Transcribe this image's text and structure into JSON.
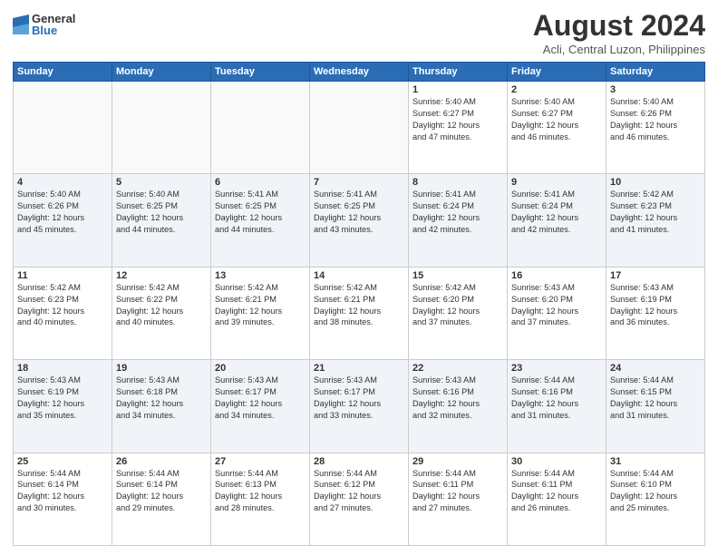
{
  "logo": {
    "general": "General",
    "blue": "Blue"
  },
  "title": "August 2024",
  "subtitle": "Acli, Central Luzon, Philippines",
  "weekdays": [
    "Sunday",
    "Monday",
    "Tuesday",
    "Wednesday",
    "Thursday",
    "Friday",
    "Saturday"
  ],
  "weeks": [
    [
      {
        "day": "",
        "info": ""
      },
      {
        "day": "",
        "info": ""
      },
      {
        "day": "",
        "info": ""
      },
      {
        "day": "",
        "info": ""
      },
      {
        "day": "1",
        "info": "Sunrise: 5:40 AM\nSunset: 6:27 PM\nDaylight: 12 hours\nand 47 minutes."
      },
      {
        "day": "2",
        "info": "Sunrise: 5:40 AM\nSunset: 6:27 PM\nDaylight: 12 hours\nand 46 minutes."
      },
      {
        "day": "3",
        "info": "Sunrise: 5:40 AM\nSunset: 6:26 PM\nDaylight: 12 hours\nand 46 minutes."
      }
    ],
    [
      {
        "day": "4",
        "info": "Sunrise: 5:40 AM\nSunset: 6:26 PM\nDaylight: 12 hours\nand 45 minutes."
      },
      {
        "day": "5",
        "info": "Sunrise: 5:40 AM\nSunset: 6:25 PM\nDaylight: 12 hours\nand 44 minutes."
      },
      {
        "day": "6",
        "info": "Sunrise: 5:41 AM\nSunset: 6:25 PM\nDaylight: 12 hours\nand 44 minutes."
      },
      {
        "day": "7",
        "info": "Sunrise: 5:41 AM\nSunset: 6:25 PM\nDaylight: 12 hours\nand 43 minutes."
      },
      {
        "day": "8",
        "info": "Sunrise: 5:41 AM\nSunset: 6:24 PM\nDaylight: 12 hours\nand 42 minutes."
      },
      {
        "day": "9",
        "info": "Sunrise: 5:41 AM\nSunset: 6:24 PM\nDaylight: 12 hours\nand 42 minutes."
      },
      {
        "day": "10",
        "info": "Sunrise: 5:42 AM\nSunset: 6:23 PM\nDaylight: 12 hours\nand 41 minutes."
      }
    ],
    [
      {
        "day": "11",
        "info": "Sunrise: 5:42 AM\nSunset: 6:23 PM\nDaylight: 12 hours\nand 40 minutes."
      },
      {
        "day": "12",
        "info": "Sunrise: 5:42 AM\nSunset: 6:22 PM\nDaylight: 12 hours\nand 40 minutes."
      },
      {
        "day": "13",
        "info": "Sunrise: 5:42 AM\nSunset: 6:21 PM\nDaylight: 12 hours\nand 39 minutes."
      },
      {
        "day": "14",
        "info": "Sunrise: 5:42 AM\nSunset: 6:21 PM\nDaylight: 12 hours\nand 38 minutes."
      },
      {
        "day": "15",
        "info": "Sunrise: 5:42 AM\nSunset: 6:20 PM\nDaylight: 12 hours\nand 37 minutes."
      },
      {
        "day": "16",
        "info": "Sunrise: 5:43 AM\nSunset: 6:20 PM\nDaylight: 12 hours\nand 37 minutes."
      },
      {
        "day": "17",
        "info": "Sunrise: 5:43 AM\nSunset: 6:19 PM\nDaylight: 12 hours\nand 36 minutes."
      }
    ],
    [
      {
        "day": "18",
        "info": "Sunrise: 5:43 AM\nSunset: 6:19 PM\nDaylight: 12 hours\nand 35 minutes."
      },
      {
        "day": "19",
        "info": "Sunrise: 5:43 AM\nSunset: 6:18 PM\nDaylight: 12 hours\nand 34 minutes."
      },
      {
        "day": "20",
        "info": "Sunrise: 5:43 AM\nSunset: 6:17 PM\nDaylight: 12 hours\nand 34 minutes."
      },
      {
        "day": "21",
        "info": "Sunrise: 5:43 AM\nSunset: 6:17 PM\nDaylight: 12 hours\nand 33 minutes."
      },
      {
        "day": "22",
        "info": "Sunrise: 5:43 AM\nSunset: 6:16 PM\nDaylight: 12 hours\nand 32 minutes."
      },
      {
        "day": "23",
        "info": "Sunrise: 5:44 AM\nSunset: 6:16 PM\nDaylight: 12 hours\nand 31 minutes."
      },
      {
        "day": "24",
        "info": "Sunrise: 5:44 AM\nSunset: 6:15 PM\nDaylight: 12 hours\nand 31 minutes."
      }
    ],
    [
      {
        "day": "25",
        "info": "Sunrise: 5:44 AM\nSunset: 6:14 PM\nDaylight: 12 hours\nand 30 minutes."
      },
      {
        "day": "26",
        "info": "Sunrise: 5:44 AM\nSunset: 6:14 PM\nDaylight: 12 hours\nand 29 minutes."
      },
      {
        "day": "27",
        "info": "Sunrise: 5:44 AM\nSunset: 6:13 PM\nDaylight: 12 hours\nand 28 minutes."
      },
      {
        "day": "28",
        "info": "Sunrise: 5:44 AM\nSunset: 6:12 PM\nDaylight: 12 hours\nand 27 minutes."
      },
      {
        "day": "29",
        "info": "Sunrise: 5:44 AM\nSunset: 6:11 PM\nDaylight: 12 hours\nand 27 minutes."
      },
      {
        "day": "30",
        "info": "Sunrise: 5:44 AM\nSunset: 6:11 PM\nDaylight: 12 hours\nand 26 minutes."
      },
      {
        "day": "31",
        "info": "Sunrise: 5:44 AM\nSunset: 6:10 PM\nDaylight: 12 hours\nand 25 minutes."
      }
    ]
  ]
}
